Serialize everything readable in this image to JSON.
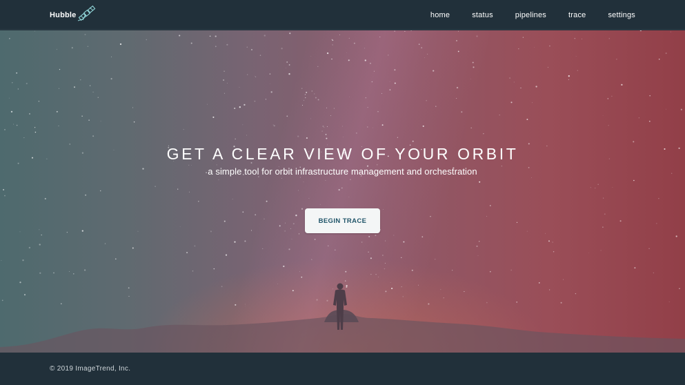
{
  "nav": {
    "brand": "Hubble",
    "brand_icon": "satellite-icon",
    "links": [
      {
        "label": "home"
      },
      {
        "label": "status"
      },
      {
        "label": "pipelines"
      },
      {
        "label": "trace"
      },
      {
        "label": "settings"
      }
    ]
  },
  "hero": {
    "title": "GET A CLEAR VIEW OF YOUR ORBIT",
    "subtitle": "a simple tool for orbit infrastructure management and orchestration",
    "cta_label": "BEGIN TRACE"
  },
  "footer": {
    "copyright": "© 2019 ImageTrend, Inc."
  },
  "colors": {
    "nav_bg": "#21303a",
    "cta_text": "#1f5468",
    "cta_bg": "#f4f6f6",
    "brand_icon_stroke": "#8fd3d6"
  }
}
